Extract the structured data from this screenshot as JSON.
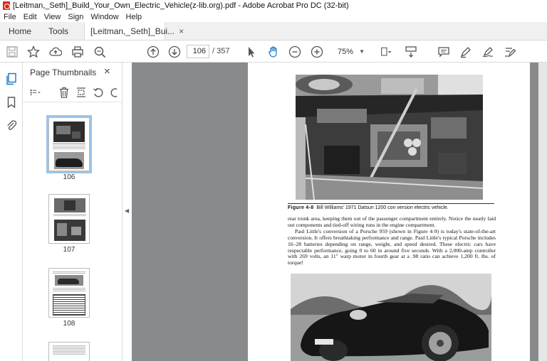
{
  "window": {
    "title": "[Leitman,_Seth]_Build_Your_Own_Electric_Vehicle(z-lib.org).pdf - Adobe Acrobat Pro DC (32-bit)"
  },
  "menu": [
    "File",
    "Edit",
    "View",
    "Sign",
    "Window",
    "Help"
  ],
  "tabs": {
    "home": "Home",
    "tools": "Tools",
    "doc": "[Leitman,_Seth]_Bui...",
    "close": "×"
  },
  "toolbar": {
    "page_current": "106",
    "page_total": "/ 357",
    "zoom": "75%"
  },
  "panel": {
    "title": "Page Thumbnails",
    "close": "×",
    "thumbnails": [
      {
        "label": "106",
        "selected": true
      },
      {
        "label": "107",
        "selected": false
      },
      {
        "label": "108",
        "selected": false
      }
    ]
  },
  "document": {
    "caption_label": "Figure 4-8",
    "caption_text": "Bill Williams' 1971 Datsun 1200 con   version electric vehicle.",
    "paragraphs": [
      "rear trunk area, keeping them out of the passenger compartment entirely. Notice the neatly laid out components and tied-off wiring runs in the engine compartment.",
      "Paul Little's conversion of a Porsche 959 (shown in Figure 4-9) is today's state-of-the-art conversion. It offers breathtaking performance and range. Paul Little's typical Porsche includes 16–28 batteries depending on range, weight, and speed desired. These electric cars have respectable performance, going 0 to 60 in around five seconds. With a 2,000-amp controller with 269 volts, an 11\" warp motor in fourth gear at a .98 ratio can achieve 1,200 ft. lbs. of torque!"
    ]
  },
  "colors": {
    "accent": "#1a73c8",
    "canvas": "#888a8c",
    "selection": "#9ec4e8"
  }
}
